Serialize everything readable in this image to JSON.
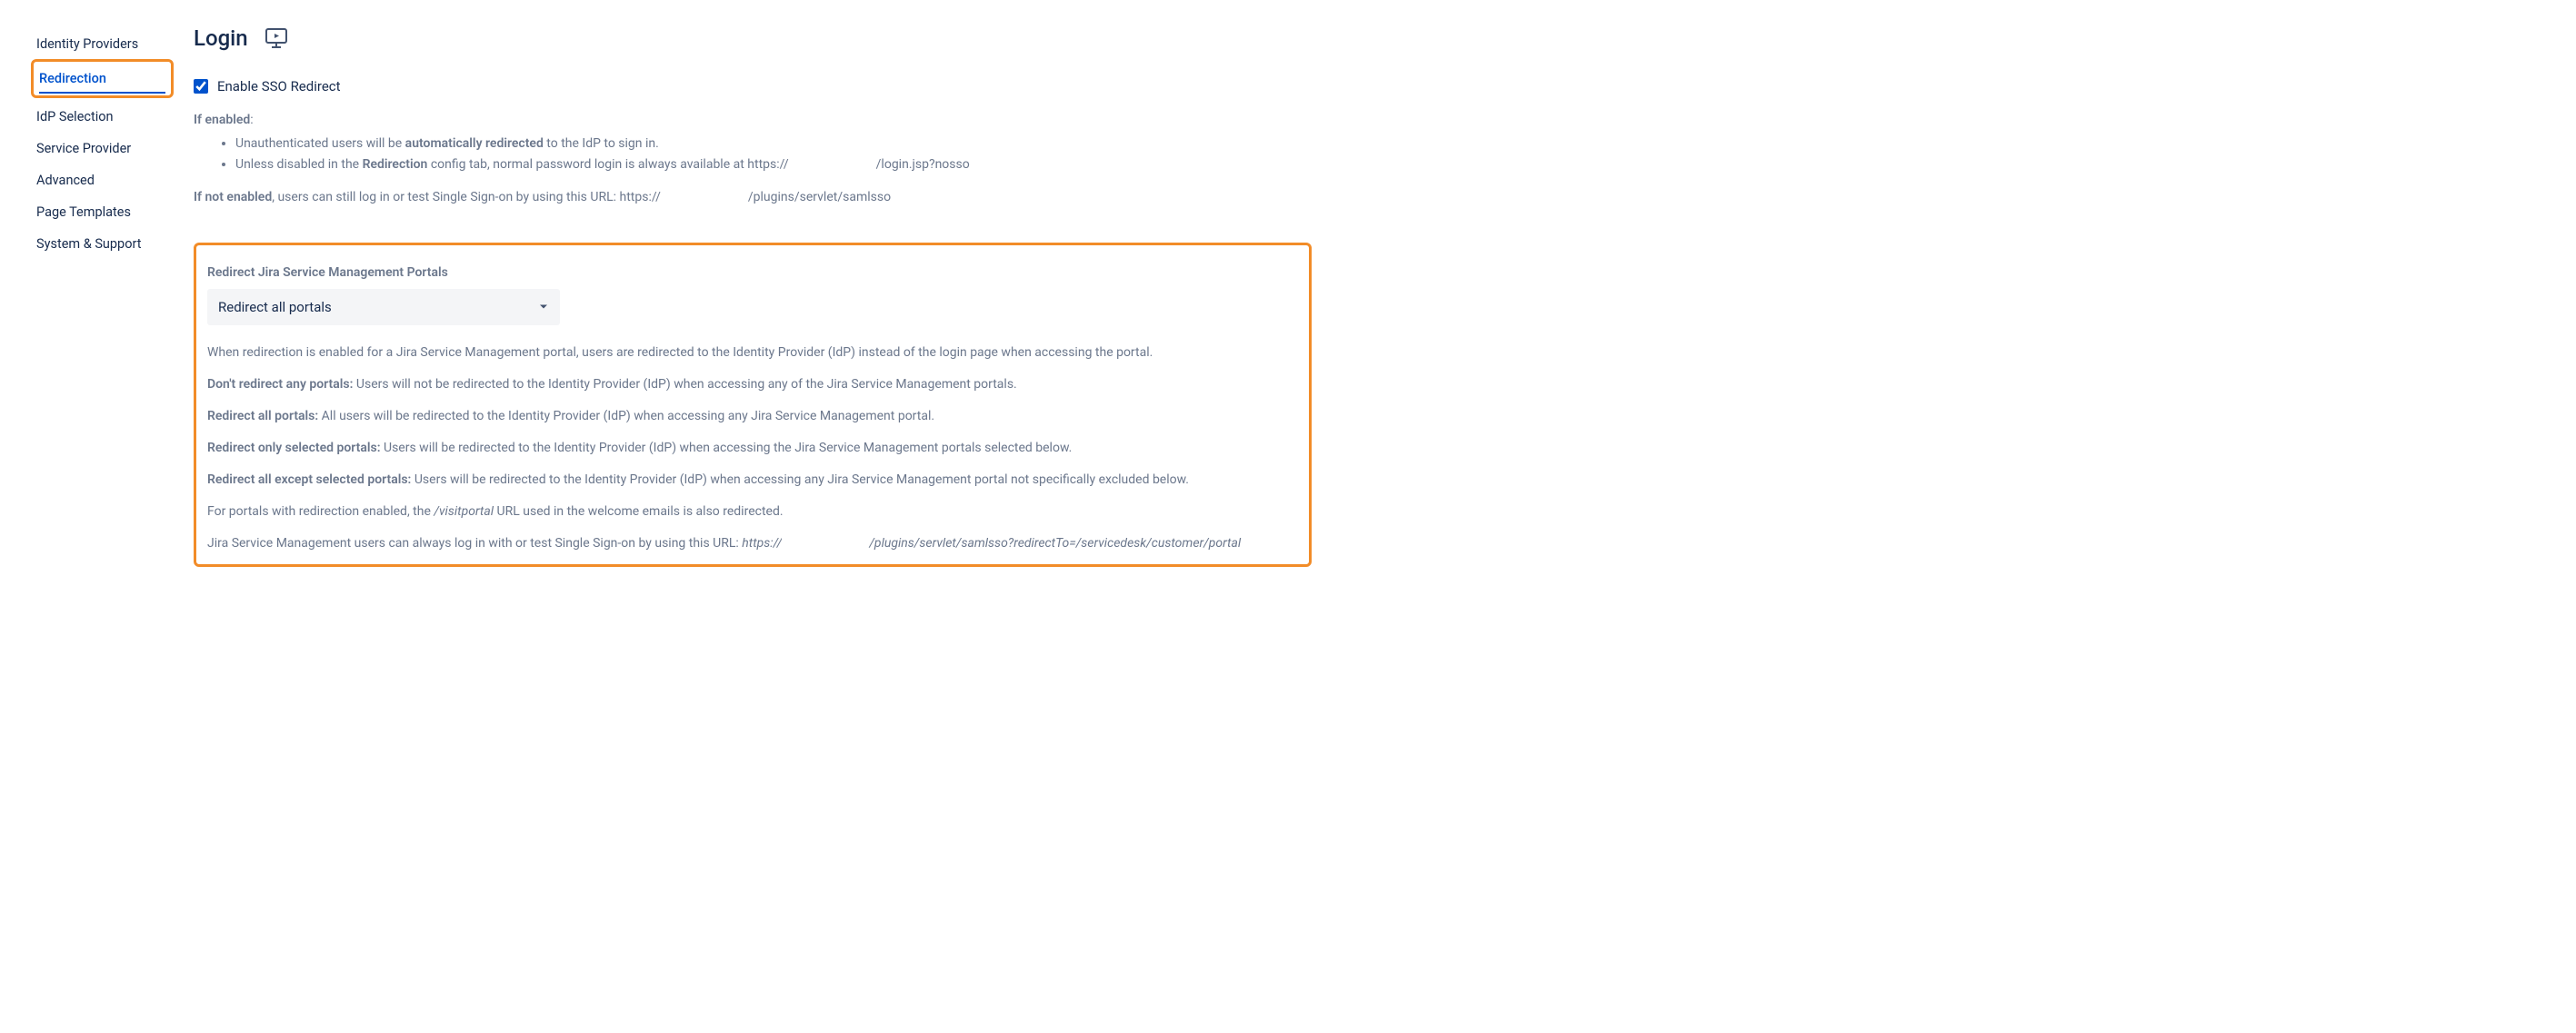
{
  "sidebar": {
    "items": [
      {
        "label": "Identity Providers"
      },
      {
        "label": "Redirection",
        "active": true
      },
      {
        "label": "IdP Selection"
      },
      {
        "label": "Service Provider"
      },
      {
        "label": "Advanced"
      },
      {
        "label": "Page Templates"
      },
      {
        "label": "System & Support"
      }
    ]
  },
  "page": {
    "title": "Login"
  },
  "enable_sso": {
    "label": "Enable SSO Redirect",
    "checked": true
  },
  "if_enabled_label": "If enabled",
  "colon": ":",
  "bullet1": {
    "prefix": "Unauthenticated users will be ",
    "strong": "automatically redirected",
    "suffix": " to the IdP to sign in."
  },
  "bullet2": {
    "prefix": "Unless disabled in the ",
    "strong": "Redirection",
    "suffix1": " config tab, normal password login is always available at https://",
    "suffix2": "/login.jsp?nosso"
  },
  "if_not_enabled": {
    "strong": "If not enabled",
    "text1": ", users can still log in or test Single Sign-on by using this URL: https://",
    "text2": "/plugins/servlet/samlsso"
  },
  "jsm": {
    "heading": "Redirect Jira Service Management Portals",
    "select_value": "Redirect all portals",
    "intro": "When redirection is enabled for a Jira Service Management portal, users are redirected to the Identity Provider (IdP) instead of the login page when accessing the portal.",
    "opt1": {
      "label": "Don't redirect any portals:",
      "text": " Users will not be redirected to the Identity Provider (IdP) when accessing any of the Jira Service Management portals."
    },
    "opt2": {
      "label": "Redirect all portals:",
      "text": " All users will be redirected to the Identity Provider (IdP) when accessing any Jira Service Management portal."
    },
    "opt3": {
      "label": "Redirect only selected portals:",
      "text": " Users will be redirected to the Identity Provider (IdP) when accessing the Jira Service Management portals selected below."
    },
    "opt4": {
      "label": "Redirect all except selected portals:",
      "text": " Users will be redirected to the Identity Provider (IdP) when accessing any Jira Service Management portal not specifically excluded below."
    },
    "visitportal": {
      "prefix": "For portals with redirection enabled, the ",
      "em": "/visitportal",
      "suffix": " URL used in the welcome emails is also redirected."
    },
    "login_url": {
      "prefix": "Jira Service Management users can always log in with or test Single Sign-on by using this URL: ",
      "em1": "https://",
      "em2": "/plugins/servlet/samlsso?redirectTo=/servicedesk/customer/portal"
    }
  }
}
